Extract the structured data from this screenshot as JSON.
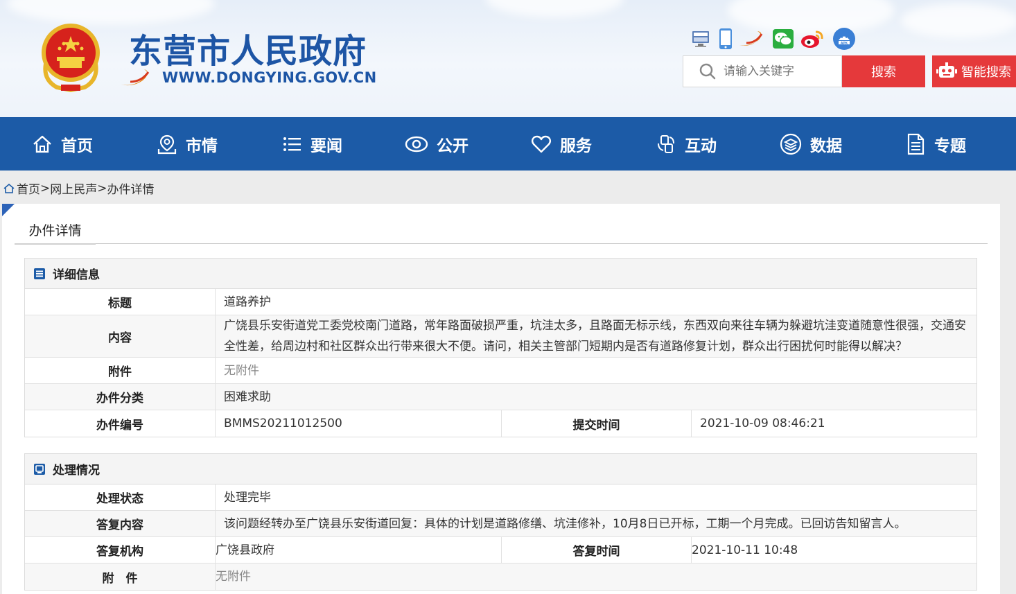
{
  "header": {
    "title": "东营市人民政府",
    "url": "WWW.DONGYING.GOV.CN",
    "search_placeholder": "请输入关键字",
    "search_label": "搜索",
    "smart_search_label": "智能搜索",
    "social_icons": [
      "gov-client-icon",
      "mobile-icon",
      "dongying-app-icon",
      "wechat-icon",
      "weibo-icon",
      "apk-icon"
    ]
  },
  "nav": {
    "items": [
      {
        "label": "首页",
        "icon": "home-icon"
      },
      {
        "label": "市情",
        "icon": "map-pin-icon"
      },
      {
        "label": "要闻",
        "icon": "list-icon"
      },
      {
        "label": "公开",
        "icon": "eye-icon"
      },
      {
        "label": "服务",
        "icon": "heart-icon"
      },
      {
        "label": "互动",
        "icon": "interaction-icon"
      },
      {
        "label": "数据",
        "icon": "layers-icon"
      },
      {
        "label": "专题",
        "icon": "document-icon"
      }
    ]
  },
  "breadcrumb": {
    "home": "首页",
    "sep1": ">",
    "level2": "网上民声",
    "sep2": ">",
    "current": "办件详情"
  },
  "panel": {
    "tab": "办件详情"
  },
  "details": {
    "heading": "详细信息",
    "title_label": "标题",
    "title_value": "道路养护",
    "content_label": "内容",
    "content_value": "广饶县乐安街道党工委党校南门道路，常年路面破损严重，坑洼太多，且路面无标示线，东西双向来往车辆为躲避坑洼变道随意性很强，交通安全性差，给周边村和社区群众出行带来很大不便。请问，相关主管部门短期内是否有道路修复计划，群众出行困扰何时能得以解决？",
    "attachment_label": "附件",
    "attachment_value": "无附件",
    "category_label": "办件分类",
    "category_value": "困难求助",
    "number_label": "办件编号",
    "number_value": "BMMS20211012500",
    "submit_time_label": "提交时间",
    "submit_time_value": "2021-10-09 08:46:21"
  },
  "processing": {
    "heading": "处理情况",
    "status_label": "处理状态",
    "status_value": "处理完毕",
    "reply_label": "答复内容",
    "reply_value": "该问题经转办至广饶县乐安街道回复：具体的计划是道路修缮、坑洼修补，10月8日已开标，工期一个月完成。已回访告知留言人。",
    "org_label": "答复机构",
    "org_value": "广饶县政府",
    "reply_time_label": "答复时间",
    "reply_time_value": "2021-10-11 10:48",
    "attachment_label": "附　件",
    "attachment_value": "无附件"
  },
  "colors": {
    "nav_bg": "#1c5ba7",
    "brand_blue": "#1d55a5",
    "search_red": "#e5393b"
  }
}
